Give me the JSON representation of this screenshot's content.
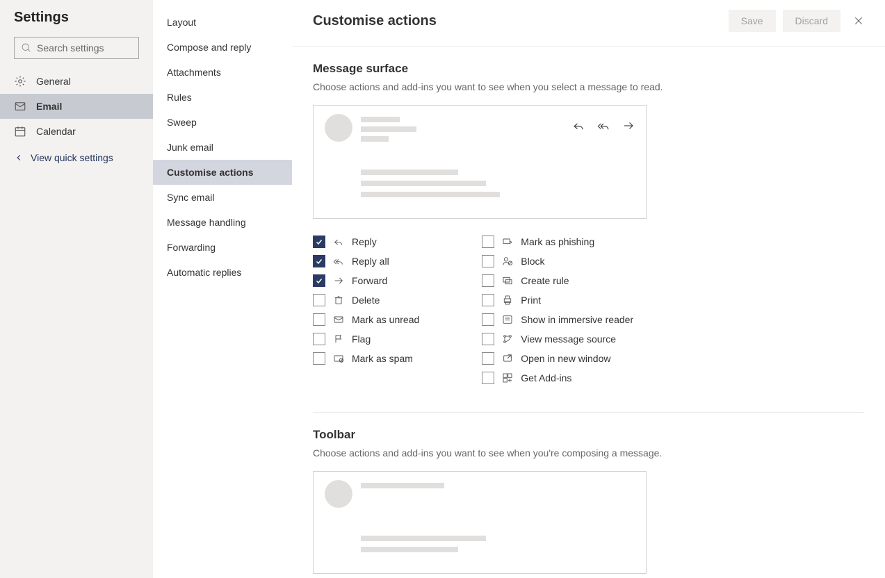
{
  "sidebar": {
    "title": "Settings",
    "search_placeholder": "Search settings",
    "categories": [
      {
        "id": "general",
        "label": "General"
      },
      {
        "id": "email",
        "label": "Email"
      },
      {
        "id": "calendar",
        "label": "Calendar"
      }
    ],
    "selected_category": "email",
    "view_quick": "View quick settings"
  },
  "subnav": {
    "items": [
      "Layout",
      "Compose and reply",
      "Attachments",
      "Rules",
      "Sweep",
      "Junk email",
      "Customise actions",
      "Sync email",
      "Message handling",
      "Forwarding",
      "Automatic replies"
    ],
    "selected_index": 6
  },
  "header": {
    "title": "Customise actions",
    "save_label": "Save",
    "discard_label": "Discard"
  },
  "sections": {
    "message_surface": {
      "title": "Message surface",
      "desc": "Choose actions and add-ins you want to see when you select a message to read.",
      "left": [
        {
          "label": "Reply",
          "checked": true,
          "icon": "reply"
        },
        {
          "label": "Reply all",
          "checked": true,
          "icon": "reply-all"
        },
        {
          "label": "Forward",
          "checked": true,
          "icon": "forward"
        },
        {
          "label": "Delete",
          "checked": false,
          "icon": "delete"
        },
        {
          "label": "Mark as unread",
          "checked": false,
          "icon": "mail"
        },
        {
          "label": "Flag",
          "checked": false,
          "icon": "flag"
        },
        {
          "label": "Mark as spam",
          "checked": false,
          "icon": "spam"
        }
      ],
      "right": [
        {
          "label": "Mark as phishing",
          "checked": false,
          "icon": "phish"
        },
        {
          "label": "Block",
          "checked": false,
          "icon": "block"
        },
        {
          "label": "Create rule",
          "checked": false,
          "icon": "rule"
        },
        {
          "label": "Print",
          "checked": false,
          "icon": "print"
        },
        {
          "label": "Show in immersive reader",
          "checked": false,
          "icon": "reader"
        },
        {
          "label": "View message source",
          "checked": false,
          "icon": "source"
        },
        {
          "label": "Open in new window",
          "checked": false,
          "icon": "window"
        },
        {
          "label": "Get Add-ins",
          "checked": false,
          "icon": "addin"
        }
      ]
    },
    "toolbar": {
      "title": "Toolbar",
      "desc": "Choose actions and add-ins you want to see when you're composing a message."
    }
  }
}
